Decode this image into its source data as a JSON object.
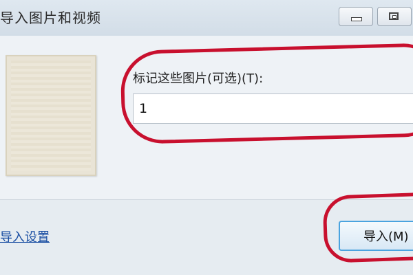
{
  "window": {
    "title": "导入图片和视频",
    "minimize_glyph": "minimize-icon",
    "maximize_glyph": "maximize-icon"
  },
  "main": {
    "tag_label": "标记这些图片(可选)(T):",
    "tag_value": "1"
  },
  "footer": {
    "settings_link": "导入设置",
    "import_button": "导入(M)"
  },
  "colors": {
    "annotation": "#c8102e",
    "link": "#1b4fa3",
    "button_border": "#4aa3df"
  }
}
